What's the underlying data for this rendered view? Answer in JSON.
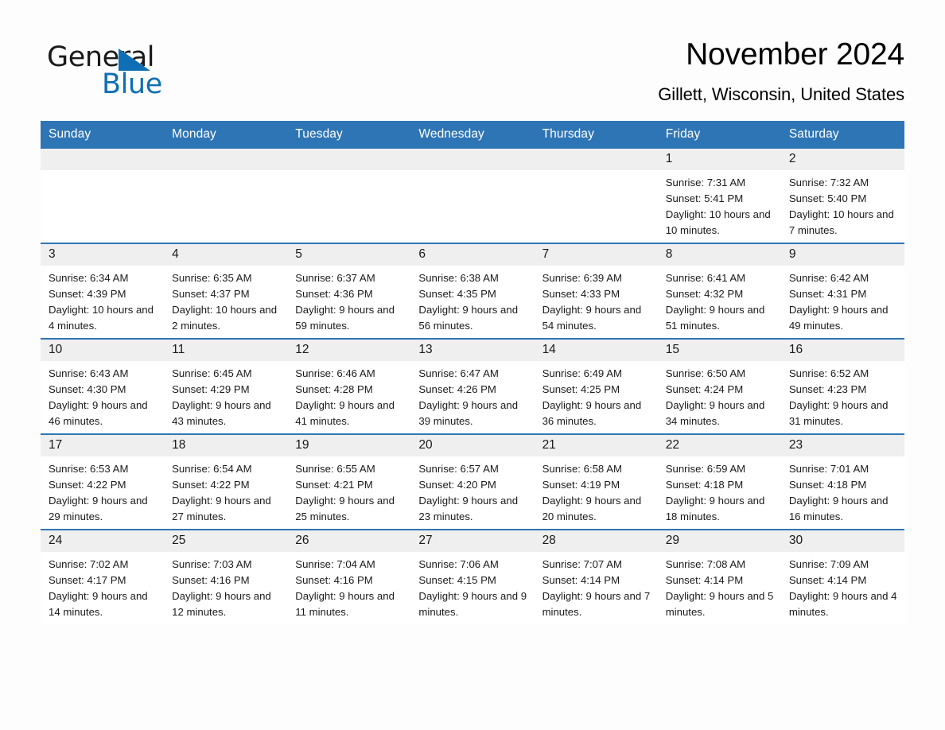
{
  "logo": {
    "word_one": "General",
    "word_two": "Blue",
    "triangle_icon": "blue-triangle-icon",
    "brand_color": "#0f6fb5"
  },
  "header": {
    "title": "November 2024",
    "subtitle": "Gillett, Wisconsin, United States"
  },
  "theme": {
    "header_blue": "#2e75b6",
    "daynum_gray": "#efefef",
    "page_background": "#fdfdfd"
  },
  "calendar": {
    "weekday_headers": [
      "Sunday",
      "Monday",
      "Tuesday",
      "Wednesday",
      "Thursday",
      "Friday",
      "Saturday"
    ],
    "weeks": [
      [
        {
          "day": "",
          "empty": true
        },
        {
          "day": "",
          "empty": true
        },
        {
          "day": "",
          "empty": true
        },
        {
          "day": "",
          "empty": true
        },
        {
          "day": "",
          "empty": true
        },
        {
          "day": "1",
          "sunrise": "Sunrise: 7:31 AM",
          "sunset": "Sunset: 5:41 PM",
          "daylight": "Daylight: 10 hours and 10 minutes."
        },
        {
          "day": "2",
          "sunrise": "Sunrise: 7:32 AM",
          "sunset": "Sunset: 5:40 PM",
          "daylight": "Daylight: 10 hours and 7 minutes."
        }
      ],
      [
        {
          "day": "3",
          "sunrise": "Sunrise: 6:34 AM",
          "sunset": "Sunset: 4:39 PM",
          "daylight": "Daylight: 10 hours and 4 minutes."
        },
        {
          "day": "4",
          "sunrise": "Sunrise: 6:35 AM",
          "sunset": "Sunset: 4:37 PM",
          "daylight": "Daylight: 10 hours and 2 minutes."
        },
        {
          "day": "5",
          "sunrise": "Sunrise: 6:37 AM",
          "sunset": "Sunset: 4:36 PM",
          "daylight": "Daylight: 9 hours and 59 minutes."
        },
        {
          "day": "6",
          "sunrise": "Sunrise: 6:38 AM",
          "sunset": "Sunset: 4:35 PM",
          "daylight": "Daylight: 9 hours and 56 minutes."
        },
        {
          "day": "7",
          "sunrise": "Sunrise: 6:39 AM",
          "sunset": "Sunset: 4:33 PM",
          "daylight": "Daylight: 9 hours and 54 minutes."
        },
        {
          "day": "8",
          "sunrise": "Sunrise: 6:41 AM",
          "sunset": "Sunset: 4:32 PM",
          "daylight": "Daylight: 9 hours and 51 minutes."
        },
        {
          "day": "9",
          "sunrise": "Sunrise: 6:42 AM",
          "sunset": "Sunset: 4:31 PM",
          "daylight": "Daylight: 9 hours and 49 minutes."
        }
      ],
      [
        {
          "day": "10",
          "sunrise": "Sunrise: 6:43 AM",
          "sunset": "Sunset: 4:30 PM",
          "daylight": "Daylight: 9 hours and 46 minutes."
        },
        {
          "day": "11",
          "sunrise": "Sunrise: 6:45 AM",
          "sunset": "Sunset: 4:29 PM",
          "daylight": "Daylight: 9 hours and 43 minutes."
        },
        {
          "day": "12",
          "sunrise": "Sunrise: 6:46 AM",
          "sunset": "Sunset: 4:28 PM",
          "daylight": "Daylight: 9 hours and 41 minutes."
        },
        {
          "day": "13",
          "sunrise": "Sunrise: 6:47 AM",
          "sunset": "Sunset: 4:26 PM",
          "daylight": "Daylight: 9 hours and 39 minutes."
        },
        {
          "day": "14",
          "sunrise": "Sunrise: 6:49 AM",
          "sunset": "Sunset: 4:25 PM",
          "daylight": "Daylight: 9 hours and 36 minutes."
        },
        {
          "day": "15",
          "sunrise": "Sunrise: 6:50 AM",
          "sunset": "Sunset: 4:24 PM",
          "daylight": "Daylight: 9 hours and 34 minutes."
        },
        {
          "day": "16",
          "sunrise": "Sunrise: 6:52 AM",
          "sunset": "Sunset: 4:23 PM",
          "daylight": "Daylight: 9 hours and 31 minutes."
        }
      ],
      [
        {
          "day": "17",
          "sunrise": "Sunrise: 6:53 AM",
          "sunset": "Sunset: 4:22 PM",
          "daylight": "Daylight: 9 hours and 29 minutes."
        },
        {
          "day": "18",
          "sunrise": "Sunrise: 6:54 AM",
          "sunset": "Sunset: 4:22 PM",
          "daylight": "Daylight: 9 hours and 27 minutes."
        },
        {
          "day": "19",
          "sunrise": "Sunrise: 6:55 AM",
          "sunset": "Sunset: 4:21 PM",
          "daylight": "Daylight: 9 hours and 25 minutes."
        },
        {
          "day": "20",
          "sunrise": "Sunrise: 6:57 AM",
          "sunset": "Sunset: 4:20 PM",
          "daylight": "Daylight: 9 hours and 23 minutes."
        },
        {
          "day": "21",
          "sunrise": "Sunrise: 6:58 AM",
          "sunset": "Sunset: 4:19 PM",
          "daylight": "Daylight: 9 hours and 20 minutes."
        },
        {
          "day": "22",
          "sunrise": "Sunrise: 6:59 AM",
          "sunset": "Sunset: 4:18 PM",
          "daylight": "Daylight: 9 hours and 18 minutes."
        },
        {
          "day": "23",
          "sunrise": "Sunrise: 7:01 AM",
          "sunset": "Sunset: 4:18 PM",
          "daylight": "Daylight: 9 hours and 16 minutes."
        }
      ],
      [
        {
          "day": "24",
          "sunrise": "Sunrise: 7:02 AM",
          "sunset": "Sunset: 4:17 PM",
          "daylight": "Daylight: 9 hours and 14 minutes."
        },
        {
          "day": "25",
          "sunrise": "Sunrise: 7:03 AM",
          "sunset": "Sunset: 4:16 PM",
          "daylight": "Daylight: 9 hours and 12 minutes."
        },
        {
          "day": "26",
          "sunrise": "Sunrise: 7:04 AM",
          "sunset": "Sunset: 4:16 PM",
          "daylight": "Daylight: 9 hours and 11 minutes."
        },
        {
          "day": "27",
          "sunrise": "Sunrise: 7:06 AM",
          "sunset": "Sunset: 4:15 PM",
          "daylight": "Daylight: 9 hours and 9 minutes."
        },
        {
          "day": "28",
          "sunrise": "Sunrise: 7:07 AM",
          "sunset": "Sunset: 4:14 PM",
          "daylight": "Daylight: 9 hours and 7 minutes."
        },
        {
          "day": "29",
          "sunrise": "Sunrise: 7:08 AM",
          "sunset": "Sunset: 4:14 PM",
          "daylight": "Daylight: 9 hours and 5 minutes."
        },
        {
          "day": "30",
          "sunrise": "Sunrise: 7:09 AM",
          "sunset": "Sunset: 4:14 PM",
          "daylight": "Daylight: 9 hours and 4 minutes."
        }
      ]
    ]
  }
}
